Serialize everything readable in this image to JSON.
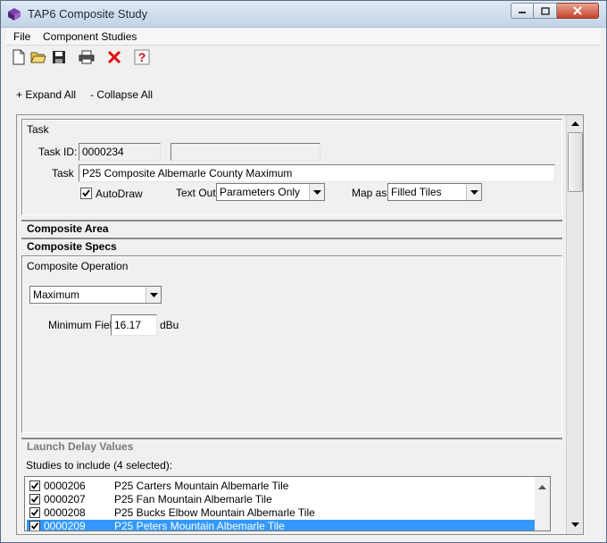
{
  "window": {
    "title": "TAP6 Composite Study"
  },
  "menu": {
    "items": [
      "File",
      "Component Studies"
    ]
  },
  "toolbar": {
    "icons": [
      "new-file-icon",
      "open-folder-icon",
      "save-icon",
      "print-icon",
      "delete-icon",
      "help-icon"
    ]
  },
  "tree": {
    "expand_all": "+ Expand All",
    "collapse_all": "- Collapse All"
  },
  "task": {
    "section_label": "Task",
    "task_id_label": "Task ID:",
    "task_id_value": "0000234",
    "task_label": "Task",
    "task_value": "P25 Composite Albemarle County Maximum",
    "autodraw_label": "AutoDraw",
    "autodraw_checked": true,
    "text_out_label": "Text Out:",
    "text_out_value": "Parameters Only",
    "map_as_label": "Map as:",
    "map_as_value": "Filled Tiles"
  },
  "sections": {
    "composite_area": "Composite Area",
    "composite_specs": "Composite Specs",
    "launch_delay": "Launch Delay Values"
  },
  "composite_operation": {
    "label": "Composite Operation",
    "value": "Maximum",
    "min_field_label": "Minimum Field",
    "min_field_value": "16.17",
    "unit": "dBu"
  },
  "studies": {
    "label": "Studies to include (4 selected):",
    "rows": [
      {
        "id": "0000206",
        "name": "P25 Carters Mountain Albemarle Tile",
        "checked": true,
        "selected": false
      },
      {
        "id": "0000207",
        "name": "P25 Fan Mountain Albemarle Tile",
        "checked": true,
        "selected": false
      },
      {
        "id": "0000208",
        "name": "P25 Bucks Elbow Mountain Albemarle Tile",
        "checked": true,
        "selected": false
      },
      {
        "id": "0000209",
        "name": "P25 Peters Mountain Albemarle Tile",
        "checked": true,
        "selected": true
      }
    ]
  },
  "colors": {
    "selection": "#3399ff",
    "close_button": "#c7432b"
  }
}
